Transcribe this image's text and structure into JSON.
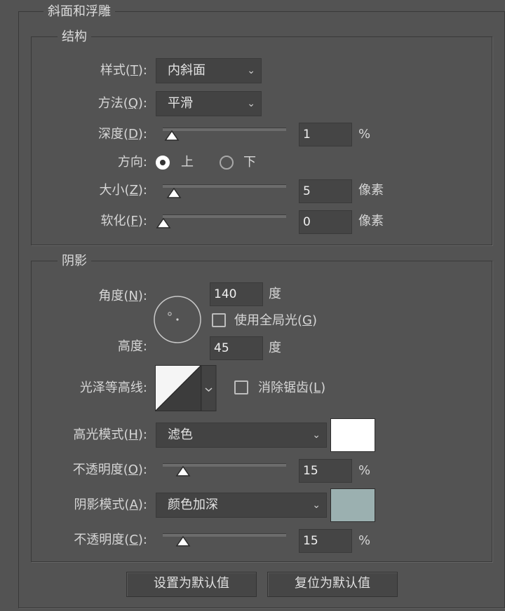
{
  "panel": {
    "title": "斜面和浮雕"
  },
  "structure": {
    "title": "结构",
    "style": {
      "label": "样式(",
      "key": "T",
      "suffix": "):",
      "value": "内斜面"
    },
    "technique": {
      "label": "方法(",
      "key": "Q",
      "suffix": "):",
      "value": "平滑"
    },
    "depth": {
      "label": "深度(",
      "key": "D",
      "suffix": "):",
      "value": "1",
      "unit": "%",
      "level_fraction": 0.01
    },
    "direction": {
      "label": "方向:",
      "options": [
        "上",
        "下"
      ],
      "selected": "上"
    },
    "size": {
      "label": "大小(",
      "key": "Z",
      "suffix": "):",
      "value": "5",
      "unit": "像素",
      "level_fraction": 0.03
    },
    "soften": {
      "label": "软化(",
      "key": "F",
      "suffix": "):",
      "value": "0",
      "unit": "像素",
      "level_fraction": 0.0
    }
  },
  "shading": {
    "title": "阴影",
    "angle": {
      "label": "角度(",
      "key": "N",
      "suffix": "):",
      "value": "140",
      "unit": "度"
    },
    "use_global_light": {
      "label": "使用全局光(",
      "key": "G",
      "suffix": ")",
      "checked": false
    },
    "altitude": {
      "label": "高度:",
      "value": "45",
      "unit": "度"
    },
    "gloss_contour": {
      "label": "光泽等高线:"
    },
    "anti_aliased": {
      "label": "消除锯齿(",
      "key": "L",
      "suffix": ")",
      "checked": false
    },
    "highlight_mode": {
      "label": "高光模式(",
      "key": "H",
      "suffix": "):",
      "value": "滤色",
      "color": "#ffffff"
    },
    "highlight_opacity": {
      "label": "不透明度(",
      "key": "O",
      "suffix": "):",
      "value": "15",
      "unit": "%",
      "level_fraction": 0.15
    },
    "shadow_mode": {
      "label": "阴影模式(",
      "key": "A",
      "suffix": "):",
      "value": "颜色加深",
      "color": "#9bb0b0"
    },
    "shadow_opacity": {
      "label": "不透明度(",
      "key": "C",
      "suffix": "):",
      "value": "15",
      "unit": "%",
      "level_fraction": 0.15
    }
  },
  "buttons": {
    "make_default": "设置为默认值",
    "reset_default": "复位为默认值"
  }
}
